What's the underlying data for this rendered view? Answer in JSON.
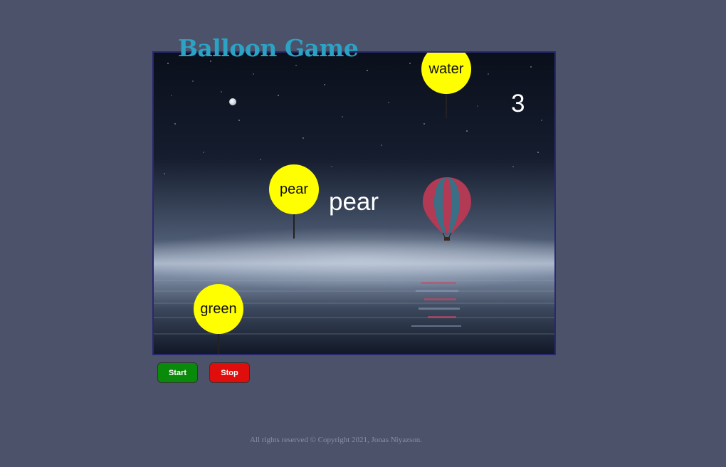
{
  "header": {
    "title": "Balloon Game"
  },
  "game": {
    "score": "3",
    "target_word": "pear",
    "balloons": [
      {
        "word": "water",
        "color": "#ffff00"
      },
      {
        "word": "pear",
        "color": "#ffff00"
      },
      {
        "word": "green",
        "color": "#ffff00"
      }
    ]
  },
  "controls": {
    "start_label": "Start",
    "stop_label": "Stop"
  },
  "footer": {
    "copyright": "All rights reserved © Copyright 2021, Jonas Niyazson."
  },
  "colors": {
    "title": "#2aa3c4",
    "page_bg": "#4c526a",
    "start_button": "#0a8a0a",
    "stop_button": "#e00d0d",
    "balloon": "#ffff00"
  }
}
